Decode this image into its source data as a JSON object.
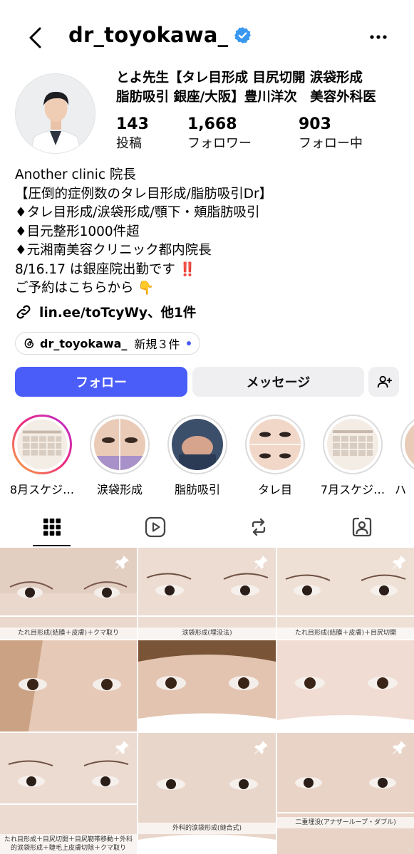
{
  "header": {
    "username": "dr_toyokawa_"
  },
  "profile": {
    "name_line1": "とよ先生【タレ目形成 目尻切開 涙袋形成",
    "name_line2": "脂肪吸引 銀座/大阪】豊川洋次　美容外科医",
    "stats": [
      {
        "value": "143",
        "label": "投稿"
      },
      {
        "value": "1,668",
        "label": "フォロワー"
      },
      {
        "value": "903",
        "label": "フォロー中"
      }
    ]
  },
  "bio": {
    "lines": [
      "Another clinic 院長",
      "【圧倒的症例数のタレ目形成/脂肪吸引Dr】",
      "♦タレ目形成/涙袋形成/顎下・頬脂肪吸引",
      "♦目元整形1000件超",
      "♦元湘南美容クリニック都内院長",
      "8/16.17 は銀座院出勤です",
      "ご予約はこちらから"
    ],
    "emoji_exclaim": "‼️",
    "emoji_point": "👇",
    "link": "lin.ee/toTcyWy、他1件"
  },
  "threads": {
    "handle": "dr_toyokawa_",
    "new_label": "新規３件"
  },
  "actions": {
    "follow": "フォロー",
    "message": "メッセージ"
  },
  "highlights": [
    {
      "label": "8月スケジ…"
    },
    {
      "label": "涙袋形成"
    },
    {
      "label": "脂肪吸引"
    },
    {
      "label": "タレ目"
    },
    {
      "label": "7月スケジ…"
    },
    {
      "label": "ハ"
    }
  ],
  "grid": {
    "captions": [
      "たれ目形成(結膜＋皮膚)＋クマ取り",
      "涙袋形成(埋没法)",
      "たれ目形成(結膜＋皮膚)＋目尻切開",
      "",
      "",
      "",
      "たれ目形成＋目尻切開＋目尻靭帯移動＋外科的涙袋形成＋睫毛上皮膚切除＋クマ取り",
      "外科的涙袋形成(縫合式)",
      "二重埋没(アナザーループ・ダブル)"
    ]
  },
  "colors": {
    "accent": "#4a5df9",
    "verified": "#3897f0"
  }
}
